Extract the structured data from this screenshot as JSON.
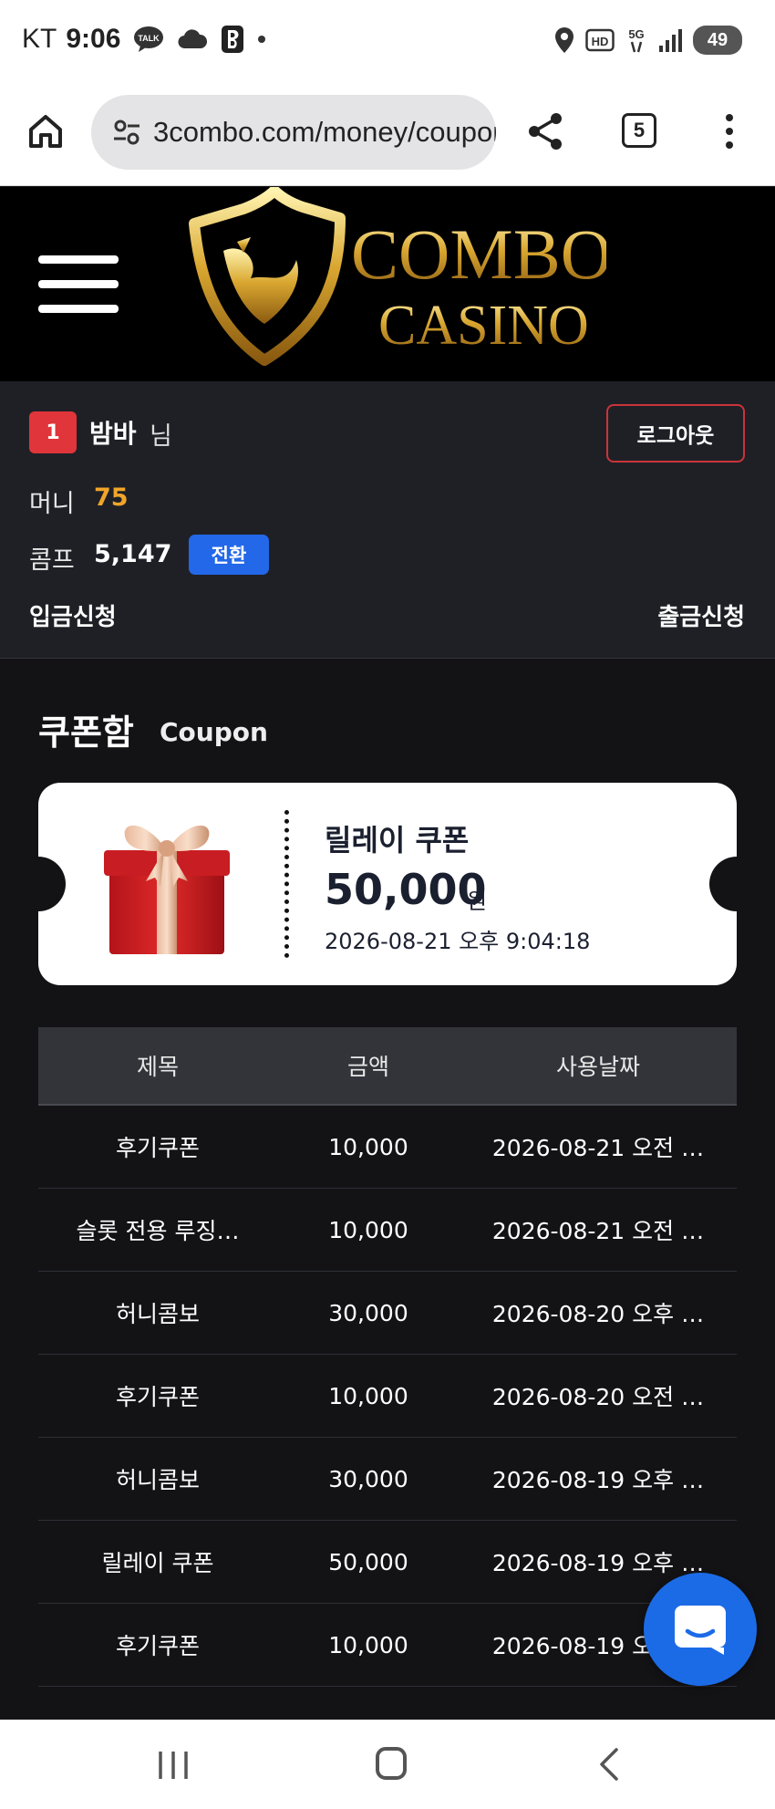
{
  "status_bar": {
    "carrier": "KT",
    "time": "9:06",
    "talk_label": "TALK",
    "hd_label": "HD",
    "network": "5G",
    "battery": "49"
  },
  "browser": {
    "url": "3combo.com/money/coupon",
    "tab_count": "5"
  },
  "site": {
    "logo_line1": "COMBO",
    "logo_line2": "CASINO"
  },
  "user": {
    "level": "1",
    "name": "밤바",
    "honorific": "님",
    "logout_label": "로그아웃",
    "money_label": "머니",
    "money_value": "75",
    "comp_label": "콤프",
    "comp_value": "5,147",
    "convert_label": "전환",
    "deposit_label": "입금신청",
    "withdraw_label": "출금신청"
  },
  "coupon_section": {
    "title": "쿠폰함",
    "subtitle": "Coupon"
  },
  "coupon_card": {
    "name": "릴레이 쿠폰",
    "amount": "50,000",
    "unit": "원",
    "date": "2026-08-21 오후 9:04:18"
  },
  "table": {
    "headers": [
      "제목",
      "금액",
      "사용날짜"
    ],
    "rows": [
      [
        "후기쿠폰",
        "10,000",
        "2026-08-21 오전 …"
      ],
      [
        "슬롯 전용 루징…",
        "10,000",
        "2026-08-21 오전 …"
      ],
      [
        "허니콤보",
        "30,000",
        "2026-08-20 오후 …"
      ],
      [
        "후기쿠폰",
        "10,000",
        "2026-08-20 오전 …"
      ],
      [
        "허니콤보",
        "30,000",
        "2026-08-19 오후 …"
      ],
      [
        "릴레이 쿠폰",
        "50,000",
        "2026-08-19 오후 …"
      ],
      [
        "후기쿠폰",
        "10,000",
        "2026-08-19 오전 …"
      ]
    ]
  },
  "colors": {
    "accent_gold": "#f0a52a",
    "badge_red": "#e0353a",
    "convert_blue": "#2368e8",
    "chat_blue": "#1c6be6"
  }
}
